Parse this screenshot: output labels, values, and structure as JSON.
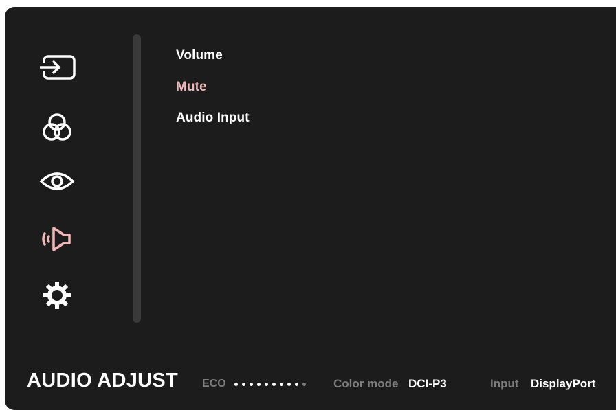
{
  "colors": {
    "panel_bg": "#1c1c1c",
    "text": "#ffffff",
    "accent": "#f0b8b8",
    "muted": "#7d7d7d"
  },
  "sidebar": {
    "items": [
      {
        "icon": "input-select-icon",
        "active": false
      },
      {
        "icon": "color-adjust-icon",
        "active": false
      },
      {
        "icon": "view-mode-icon",
        "active": false
      },
      {
        "icon": "audio-speaker-icon",
        "active": true
      },
      {
        "icon": "setup-gear-icon",
        "active": false
      }
    ]
  },
  "menu": {
    "items": [
      {
        "label": "Volume",
        "selected": false
      },
      {
        "label": "Mute",
        "selected": true
      },
      {
        "label": "Audio Input",
        "selected": false
      }
    ]
  },
  "footer": {
    "title": "AUDIO ADJUST",
    "eco_label": "ECO",
    "eco_level": {
      "filled": 9,
      "total": 10
    },
    "color_mode_label": "Color mode",
    "color_mode_value": "DCI-P3",
    "input_label": "Input",
    "input_value": "DisplayPort"
  }
}
